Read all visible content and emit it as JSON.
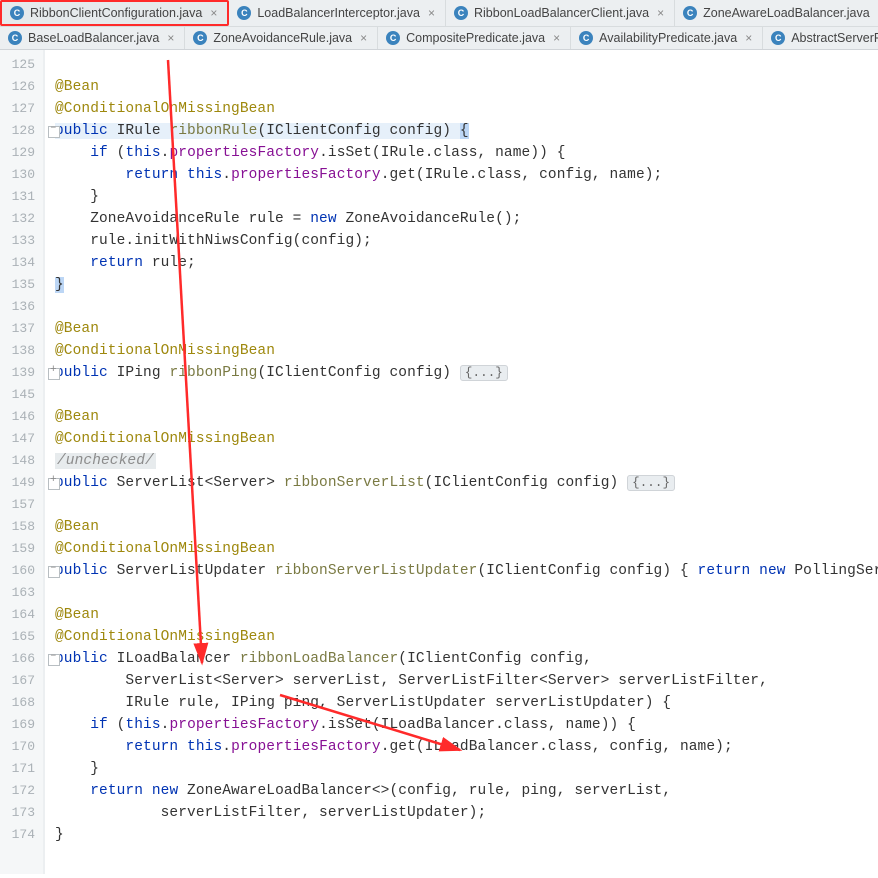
{
  "tabs_row1": [
    {
      "label": "RibbonClientConfiguration.java",
      "active": true
    },
    {
      "label": "LoadBalancerInterceptor.java",
      "active": false
    },
    {
      "label": "RibbonLoadBalancerClient.java",
      "active": false
    },
    {
      "label": "ZoneAwareLoadBalancer.java",
      "active": false
    }
  ],
  "tabs_row2": [
    {
      "label": "BaseLoadBalancer.java",
      "active": false
    },
    {
      "label": "ZoneAvoidanceRule.java",
      "active": false
    },
    {
      "label": "CompositePredicate.java",
      "active": false
    },
    {
      "label": "AvailabilityPredicate.java",
      "active": false
    },
    {
      "label": "AbstractServerP",
      "active": false
    }
  ],
  "file_icon_letter": "C",
  "close_glyph": "×",
  "line_numbers": [
    "125",
    "126",
    "127",
    "128",
    "129",
    "130",
    "131",
    "132",
    "133",
    "134",
    "135",
    "136",
    "137",
    "138",
    "139",
    "145",
    "146",
    "147",
    "148",
    "149",
    "157",
    "158",
    "159",
    "160",
    "163",
    "164",
    "165",
    "166",
    "167",
    "168",
    "169",
    "170",
    "171",
    "172",
    "173",
    "174"
  ],
  "ann_bean": "@Bean",
  "ann_cond": "@ConditionalOnMissingBean",
  "kw_public": "public",
  "kw_if": "if",
  "kw_return": "return",
  "kw_new": "new",
  "kw_this": "this",
  "t_irule": "IRule",
  "t_iping": "IPing",
  "t_iclient": "IClientConfig",
  "t_ilb": "ILoadBalancer",
  "t_zar": "ZoneAvoidanceRule",
  "t_slist": "ServerList",
  "t_server": "Server",
  "t_slu": "ServerListUpdater",
  "t_slf": "ServerListFilter",
  "t_zalb": "ZoneAwareLoadBalancer",
  "t_polling": "PollingServe",
  "m_ribbonRule": "ribbonRule",
  "m_ribbonPing": "ribbonPing",
  "m_ribbonServerList": "ribbonServerList",
  "m_ribbonSLU": "ribbonServerListUpdater",
  "m_ribbonLB": "ribbonLoadBalancer",
  "m_isSet": "isSet",
  "m_get": "get",
  "m_init": "initWithNiwsConfig",
  "f_propsFactory": "propertiesFactory",
  "p_config": "config",
  "p_name": "name",
  "p_rule": "rule",
  "p_ping": "ping",
  "p_serverList": "serverList",
  "p_slf": "serverListFilter",
  "p_slu": "serverListUpdater",
  "c_class": ".class",
  "fold_dots": "{...}",
  "c_unchecked": "/unchecked/"
}
